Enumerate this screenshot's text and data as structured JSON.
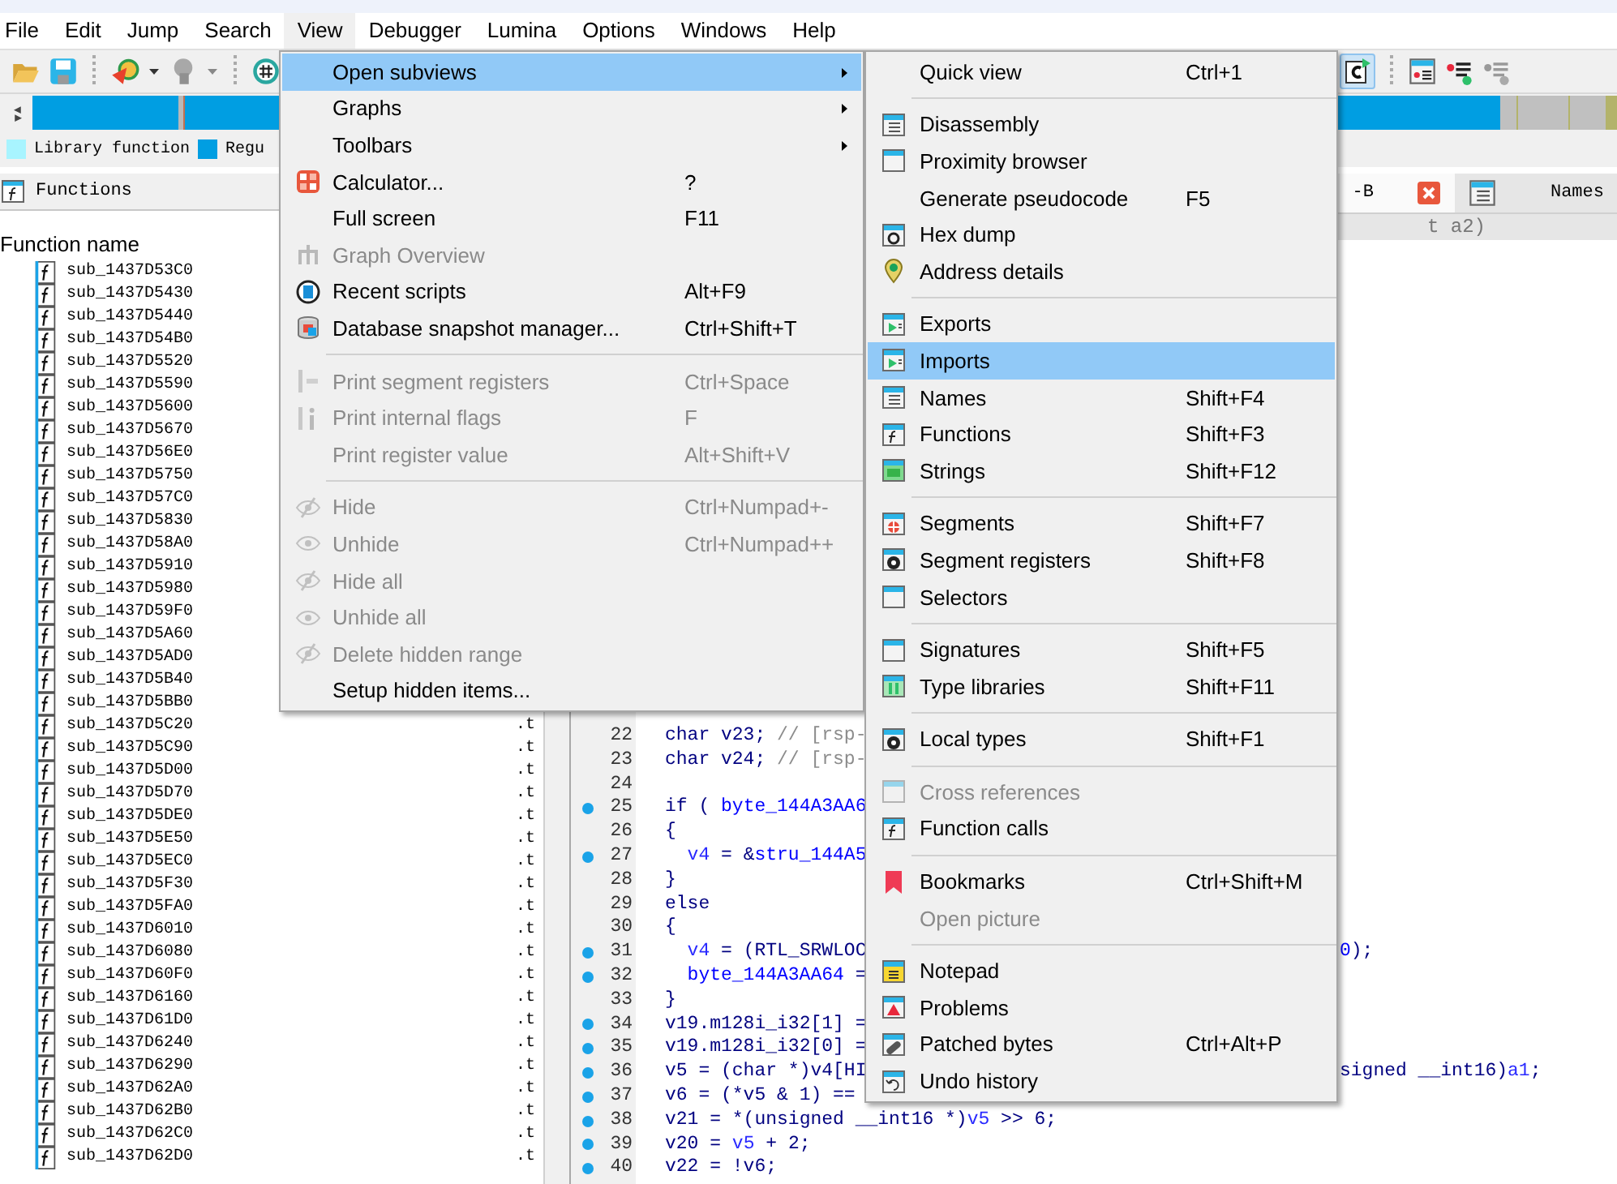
{
  "menu_bar": [
    {
      "label": "File",
      "selected": false
    },
    {
      "label": "Edit",
      "selected": false
    },
    {
      "label": "Jump",
      "selected": false
    },
    {
      "label": "Search",
      "selected": false
    },
    {
      "label": "View",
      "selected": true
    },
    {
      "label": "Debugger",
      "selected": false
    },
    {
      "label": "Lumina",
      "selected": false
    },
    {
      "label": "Options",
      "selected": false
    },
    {
      "label": "Windows",
      "selected": false
    },
    {
      "label": "Help",
      "selected": false
    }
  ],
  "legend": [
    {
      "label": "Library function",
      "color": "#a8f4ff"
    },
    {
      "label": "Regu",
      "color": "#009ee2"
    }
  ],
  "functions_panel": {
    "title": "Functions",
    "column": "Function name",
    "rows": [
      {
        "name": "sub_1437D53C0"
      },
      {
        "name": "sub_1437D5430"
      },
      {
        "name": "sub_1437D5440"
      },
      {
        "name": "sub_1437D54B0"
      },
      {
        "name": "sub_1437D5520"
      },
      {
        "name": "sub_1437D5590"
      },
      {
        "name": "sub_1437D5600"
      },
      {
        "name": "sub_1437D5670"
      },
      {
        "name": "sub_1437D56E0"
      },
      {
        "name": "sub_1437D5750"
      },
      {
        "name": "sub_1437D57C0"
      },
      {
        "name": "sub_1437D5830"
      },
      {
        "name": "sub_1437D58A0"
      },
      {
        "name": "sub_1437D5910"
      },
      {
        "name": "sub_1437D5980"
      },
      {
        "name": "sub_1437D59F0"
      },
      {
        "name": "sub_1437D5A60"
      },
      {
        "name": "sub_1437D5AD0"
      },
      {
        "name": "sub_1437D5B40"
      },
      {
        "name": "sub_1437D5BB0"
      },
      {
        "name": "sub_1437D5C20",
        "segment": ".t"
      },
      {
        "name": "sub_1437D5C90",
        "segment": ".t"
      },
      {
        "name": "sub_1437D5D00",
        "segment": ".t"
      },
      {
        "name": "sub_1437D5D70",
        "segment": ".t"
      },
      {
        "name": "sub_1437D5DE0",
        "segment": ".t"
      },
      {
        "name": "sub_1437D5E50",
        "segment": ".t"
      },
      {
        "name": "sub_1437D5EC0",
        "segment": ".t"
      },
      {
        "name": "sub_1437D5F30",
        "segment": ".t"
      },
      {
        "name": "sub_1437D5FA0",
        "segment": ".t"
      },
      {
        "name": "sub_1437D6010",
        "segment": ".t"
      },
      {
        "name": "sub_1437D6080",
        "segment": ".t"
      },
      {
        "name": "sub_1437D60F0",
        "segment": ".t"
      },
      {
        "name": "sub_1437D6160",
        "segment": ".t"
      },
      {
        "name": "sub_1437D61D0",
        "segment": ".t"
      },
      {
        "name": "sub_1437D6240",
        "segment": ".t"
      },
      {
        "name": "sub_1437D6290",
        "segment": ".t"
      },
      {
        "name": "sub_1437D62A0",
        "segment": ".t"
      },
      {
        "name": "sub_1437D62B0",
        "segment": ".t"
      },
      {
        "name": "sub_1437D62C0",
        "segment": ".t"
      },
      {
        "name": "sub_1437D62D0",
        "segment": ".t"
      }
    ]
  },
  "code_view": {
    "tabs": [
      {
        "label": "-B",
        "selected": true,
        "closable": true
      },
      {
        "label": "Names",
        "selected": false,
        "closable": false
      }
    ],
    "header_line": "t a2)",
    "lines": [
      {
        "number": "22",
        "marked": false,
        "text": [
          {
            "kind": "plain",
            "text": "char v23; "
          },
          {
            "kind": "comment",
            "text": "// [rsp-"
          }
        ]
      },
      {
        "number": "23",
        "marked": false,
        "text": [
          {
            "kind": "plain",
            "text": "char v24; "
          },
          {
            "kind": "comment",
            "text": "// [rsp-"
          }
        ]
      },
      {
        "number": "24",
        "marked": false
      },
      {
        "number": "25",
        "marked": true,
        "text": [
          {
            "kind": "plain",
            "text": "if ( "
          },
          {
            "kind": "global",
            "text": "byte_144A3AA6"
          }
        ]
      },
      {
        "number": "26",
        "marked": false,
        "text": [
          {
            "kind": "plain",
            "text": "{"
          }
        ]
      },
      {
        "number": "27",
        "marked": true,
        "indent": true,
        "text": [
          {
            "kind": "local",
            "text": "v4"
          },
          {
            "kind": "plain",
            "text": " = &"
          },
          {
            "kind": "global",
            "text": "stru_144A5"
          }
        ]
      },
      {
        "number": "28",
        "marked": false,
        "text": [
          {
            "kind": "plain",
            "text": "}"
          }
        ]
      },
      {
        "number": "29",
        "marked": false,
        "text": [
          {
            "kind": "plain",
            "text": "else"
          }
        ]
      },
      {
        "number": "30",
        "marked": false,
        "text": [
          {
            "kind": "plain",
            "text": "{"
          }
        ]
      },
      {
        "number": "31",
        "marked": true,
        "indent": true,
        "text": [
          {
            "kind": "local",
            "text": "v4"
          },
          {
            "kind": "plain",
            "text": " = (RTL_SRWLOC"
          }
        ],
        "right": [
          {
            "kind": "global",
            "text": "0"
          },
          {
            "kind": "plain",
            "text": ");"
          }
        ]
      },
      {
        "number": "32",
        "marked": true,
        "indent": true,
        "text": [
          {
            "kind": "global",
            "text": "byte_144A3AA64"
          },
          {
            "kind": "plain",
            "text": " ="
          }
        ]
      },
      {
        "number": "33",
        "marked": false,
        "text": [
          {
            "kind": "plain",
            "text": "}"
          }
        ]
      },
      {
        "number": "34",
        "marked": true,
        "text": [
          {
            "kind": "plain",
            "text": "v19.m128i_i32[1] ="
          }
        ]
      },
      {
        "number": "35",
        "marked": true,
        "text": [
          {
            "kind": "plain",
            "text": "v19.m128i_i32[0] ="
          }
        ]
      },
      {
        "number": "36",
        "marked": true,
        "text": [
          {
            "kind": "plain",
            "text": "v5 = (char *)v4[HI"
          }
        ],
        "right": [
          {
            "kind": "plain",
            "text": "signed __int16)"
          },
          {
            "kind": "local",
            "text": "a1"
          },
          {
            "kind": "plain",
            "text": ";"
          }
        ]
      },
      {
        "number": "37",
        "marked": true,
        "text": [
          {
            "kind": "plain",
            "text": "v6 = (*v5 & 1) =="
          }
        ]
      },
      {
        "number": "38",
        "marked": true,
        "text": [
          {
            "kind": "plain",
            "text": "v21 = *(unsigned __int16 *)"
          },
          {
            "kind": "local",
            "text": "v5"
          },
          {
            "kind": "plain",
            "text": " >> 6;"
          }
        ]
      },
      {
        "number": "39",
        "marked": true,
        "text": [
          {
            "kind": "plain",
            "text": "v20 = "
          },
          {
            "kind": "local",
            "text": "v5"
          },
          {
            "kind": "plain",
            "text": " + 2;"
          }
        ]
      },
      {
        "number": "40",
        "marked": true,
        "text": [
          {
            "kind": "plain",
            "text": "v22 = !v6;"
          }
        ]
      }
    ]
  },
  "view_menu": {
    "items": [
      {
        "kind": "item",
        "label": "Open subviews",
        "submenu": true,
        "disabled": false,
        "selected": true
      },
      {
        "kind": "item",
        "label": "Graphs",
        "submenu": true,
        "disabled": false,
        "selected": false
      },
      {
        "kind": "item",
        "label": "Toolbars",
        "submenu": true,
        "disabled": false,
        "selected": false
      },
      {
        "kind": "item",
        "label": "Calculator...",
        "shortcut": "?",
        "disabled": false,
        "selected": false
      },
      {
        "kind": "item",
        "label": "Full screen",
        "shortcut": "F11",
        "disabled": false,
        "selected": false
      },
      {
        "kind": "item",
        "label": "Graph Overview",
        "disabled": true,
        "selected": false
      },
      {
        "kind": "item",
        "label": "Recent scripts",
        "shortcut": "Alt+F9",
        "disabled": false,
        "selected": false
      },
      {
        "kind": "item",
        "label": "Database snapshot manager...",
        "shortcut": "Ctrl+Shift+T",
        "disabled": false,
        "selected": false
      },
      {
        "kind": "separator"
      },
      {
        "kind": "item",
        "label": "Print segment registers",
        "shortcut": "Ctrl+Space",
        "disabled": true,
        "selected": false
      },
      {
        "kind": "item",
        "label": "Print internal flags",
        "shortcut": "F",
        "disabled": true,
        "selected": false
      },
      {
        "kind": "item",
        "label": "Print register value",
        "shortcut": "Alt+Shift+V",
        "disabled": true,
        "selected": false
      },
      {
        "kind": "separator"
      },
      {
        "kind": "item",
        "label": "Hide",
        "shortcut": "Ctrl+Numpad+-",
        "disabled": true,
        "selected": false
      },
      {
        "kind": "item",
        "label": "Unhide",
        "shortcut": "Ctrl+Numpad++",
        "disabled": true,
        "selected": false
      },
      {
        "kind": "item",
        "label": "Hide all",
        "disabled": true,
        "selected": false
      },
      {
        "kind": "item",
        "label": "Unhide all",
        "disabled": true,
        "selected": false
      },
      {
        "kind": "item",
        "label": "Delete hidden range",
        "disabled": true,
        "selected": false
      },
      {
        "kind": "item",
        "label": "Setup hidden items...",
        "disabled": false,
        "selected": false
      }
    ]
  },
  "subviews_menu": {
    "items": [
      {
        "kind": "item",
        "label": "Quick view",
        "shortcut": "Ctrl+1",
        "disabled": false,
        "selected": false
      },
      {
        "kind": "separator"
      },
      {
        "kind": "item",
        "label": "Disassembly",
        "disabled": false,
        "selected": false
      },
      {
        "kind": "item",
        "label": "Proximity browser",
        "disabled": false,
        "selected": false
      },
      {
        "kind": "item",
        "label": "Generate pseudocode",
        "shortcut": "F5",
        "disabled": false,
        "selected": false
      },
      {
        "kind": "item",
        "label": "Hex dump",
        "disabled": false,
        "selected": false
      },
      {
        "kind": "item",
        "label": "Address details",
        "disabled": false,
        "selected": false
      },
      {
        "kind": "separator"
      },
      {
        "kind": "item",
        "label": "Exports",
        "disabled": false,
        "selected": false
      },
      {
        "kind": "item",
        "label": "Imports",
        "disabled": false,
        "selected": true
      },
      {
        "kind": "item",
        "label": "Names",
        "shortcut": "Shift+F4",
        "disabled": false,
        "selected": false
      },
      {
        "kind": "item",
        "label": "Functions",
        "shortcut": "Shift+F3",
        "disabled": false,
        "selected": false
      },
      {
        "kind": "item",
        "label": "Strings",
        "shortcut": "Shift+F12",
        "disabled": false,
        "selected": false
      },
      {
        "kind": "separator"
      },
      {
        "kind": "item",
        "label": "Segments",
        "shortcut": "Shift+F7",
        "disabled": false,
        "selected": false
      },
      {
        "kind": "item",
        "label": "Segment registers",
        "shortcut": "Shift+F8",
        "disabled": false,
        "selected": false
      },
      {
        "kind": "item",
        "label": "Selectors",
        "disabled": false,
        "selected": false
      },
      {
        "kind": "separator"
      },
      {
        "kind": "item",
        "label": "Signatures",
        "shortcut": "Shift+F5",
        "disabled": false,
        "selected": false
      },
      {
        "kind": "item",
        "label": "Type libraries",
        "shortcut": "Shift+F11",
        "disabled": false,
        "selected": false
      },
      {
        "kind": "separator"
      },
      {
        "kind": "item",
        "label": "Local types",
        "shortcut": "Shift+F1",
        "disabled": false,
        "selected": false
      },
      {
        "kind": "separator"
      },
      {
        "kind": "item",
        "label": "Cross references",
        "disabled": true,
        "selected": false
      },
      {
        "kind": "item",
        "label": "Function calls",
        "disabled": false,
        "selected": false
      },
      {
        "kind": "separator"
      },
      {
        "kind": "item",
        "label": "Bookmarks",
        "shortcut": "Ctrl+Shift+M",
        "disabled": false,
        "selected": false
      },
      {
        "kind": "item",
        "label": "Open picture",
        "disabled": true,
        "selected": false
      },
      {
        "kind": "separator"
      },
      {
        "kind": "item",
        "label": "Notepad",
        "disabled": false,
        "selected": false
      },
      {
        "kind": "item",
        "label": "Problems",
        "disabled": false,
        "selected": false
      },
      {
        "kind": "item",
        "label": "Patched bytes",
        "shortcut": "Ctrl+Alt+P",
        "disabled": false,
        "selected": false
      },
      {
        "kind": "item",
        "label": "Undo history",
        "disabled": false,
        "selected": false
      }
    ]
  }
}
